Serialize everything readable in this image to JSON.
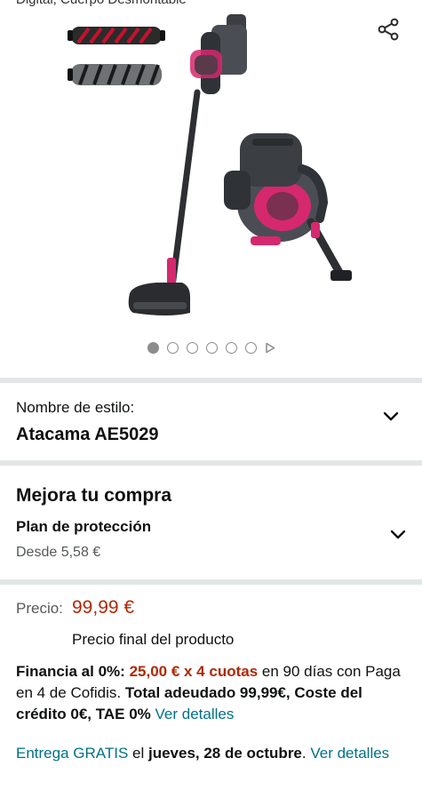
{
  "header": {
    "clipped_title": "Digital, Cuerpo Desmontable"
  },
  "gallery": {
    "image_count": 6,
    "active_index": 0,
    "share_icon": "share-icon",
    "next_icon": "play-next-icon"
  },
  "style": {
    "label": "Nombre de estilo:",
    "value": "Atacama AE5029"
  },
  "upgrade": {
    "title": "Mejora tu compra",
    "plan_title": "Plan de protección",
    "plan_price": "Desde 5,58 €"
  },
  "price": {
    "label": "Precio:",
    "value": "99,99 €",
    "final_note": "Precio final del producto"
  },
  "financing": {
    "lead": "Financia al 0%:",
    "installments": "25,00 € x 4 cuotas",
    "mid": " en 90 días con Paga en 4 de Cofidis. ",
    "total": "Total adeudado 99,99€, Coste del crédito 0€, TAE 0%",
    "link": "Ver detalles"
  },
  "delivery": {
    "prefix": "Entrega GRATIS",
    "mid": " el ",
    "date": "jueves, 28 de octubre",
    "suffix": ". ",
    "link": "Ver detalles"
  },
  "colors": {
    "price_red": "#b12704",
    "link_teal": "#007185",
    "divider": "#e3e6e6",
    "product_magenta": "#d6286e"
  }
}
